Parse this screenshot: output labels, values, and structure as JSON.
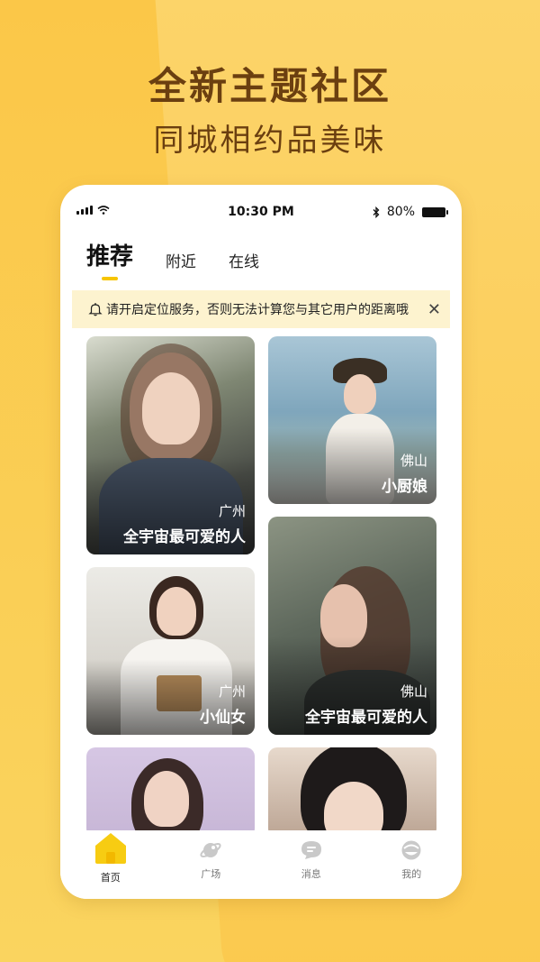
{
  "promo": {
    "headline": "全新主题社区",
    "subline": "同城相约品美味"
  },
  "statusbar": {
    "time": "10:30 PM",
    "battery": "80%"
  },
  "tabs": [
    {
      "label": "推荐",
      "active": true
    },
    {
      "label": "附近",
      "active": false
    },
    {
      "label": "在线",
      "active": false
    }
  ],
  "notice": {
    "text": "请开启定位服务，否则无法计算您与其它用户的距离哦"
  },
  "cards": [
    {
      "city": "广州",
      "name": "全宇宙最可爱的人"
    },
    {
      "city": "佛山",
      "name": "小厨娘"
    },
    {
      "city": "广州",
      "name": "小仙女"
    },
    {
      "city": "佛山",
      "name": "全宇宙最可爱的人"
    }
  ],
  "bottom_nav": [
    {
      "label": "首页",
      "icon": "home-icon",
      "active": true
    },
    {
      "label": "广场",
      "icon": "planet-icon",
      "active": false
    },
    {
      "label": "消息",
      "icon": "chat-icon",
      "active": false
    },
    {
      "label": "我的",
      "icon": "profile-icon",
      "active": false
    }
  ],
  "colors": {
    "accent": "#f7c500",
    "background": "#fbc748",
    "headline": "#6b3f10",
    "notice_bg": "#fdf3cf"
  }
}
